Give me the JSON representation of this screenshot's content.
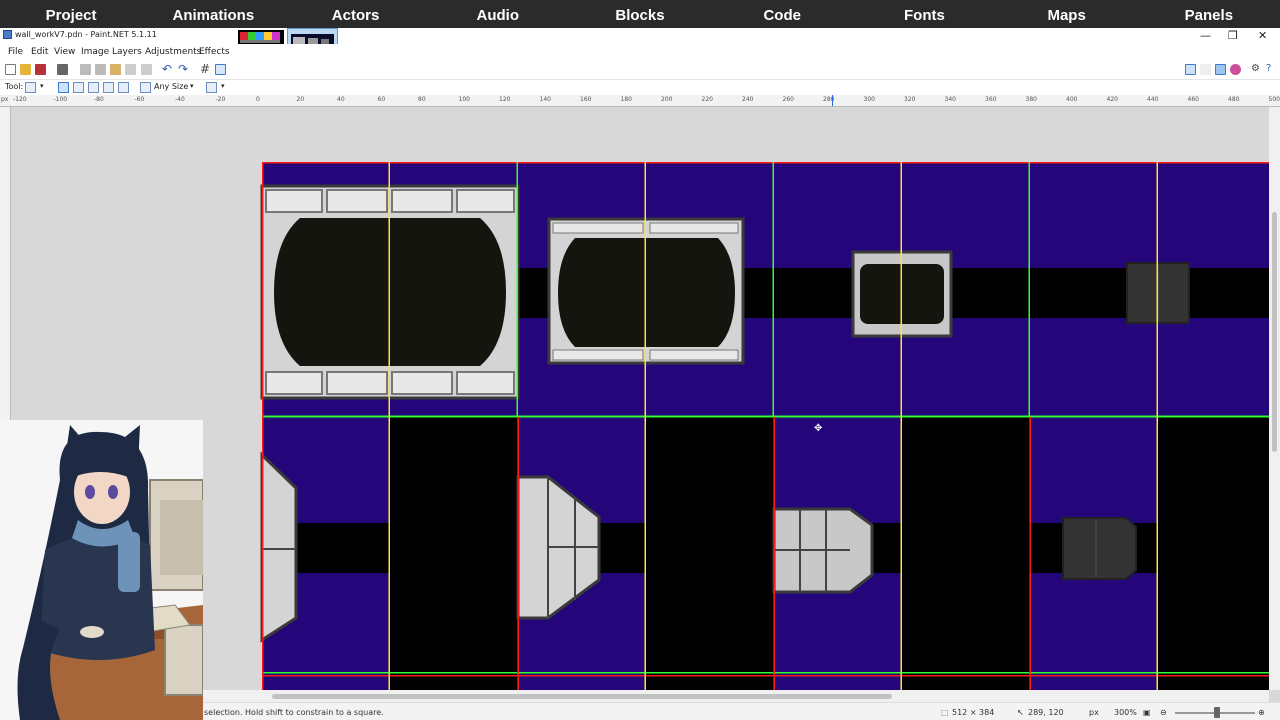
{
  "topnav": [
    "Project",
    "Animations",
    "Actors",
    "Audio",
    "Blocks",
    "Code",
    "Fonts",
    "Maps",
    "Panels"
  ],
  "window": {
    "title": "wall_workV7.pdn - Paint.NET 5.1.11"
  },
  "menu": [
    "File",
    "Edit",
    "View",
    "Image",
    "Layers",
    "Adjustments",
    "Effects"
  ],
  "toolbar2": {
    "tool_label": "Tool:",
    "size_label": "Any Size"
  },
  "ruler": {
    "unit": "px",
    "h_labels": [
      "-120",
      "-100",
      "-80",
      "-60",
      "-40",
      "-20",
      "0",
      "20",
      "40",
      "60",
      "80",
      "100",
      "120",
      "140",
      "160",
      "180",
      "200",
      "220",
      "240",
      "260",
      "280",
      "300",
      "320",
      "340",
      "360",
      "380",
      "400",
      "420",
      "440",
      "460",
      "480",
      "500"
    ]
  },
  "statusbar": {
    "hint": "selection. Hold shift to constrain to a square.",
    "image_size": "512 × 384",
    "cursor_pos": "289, 120",
    "unit": "px",
    "zoom": "300%"
  },
  "colors": {
    "tile_blue": "#24067a",
    "guide_red": "#ff1a1a",
    "guide_green": "#30ff30",
    "guide_yellow": "#ffe23a",
    "metal_light": "#d4d4d4",
    "metal_dark": "#3a3a3a",
    "hole": "#151510"
  }
}
